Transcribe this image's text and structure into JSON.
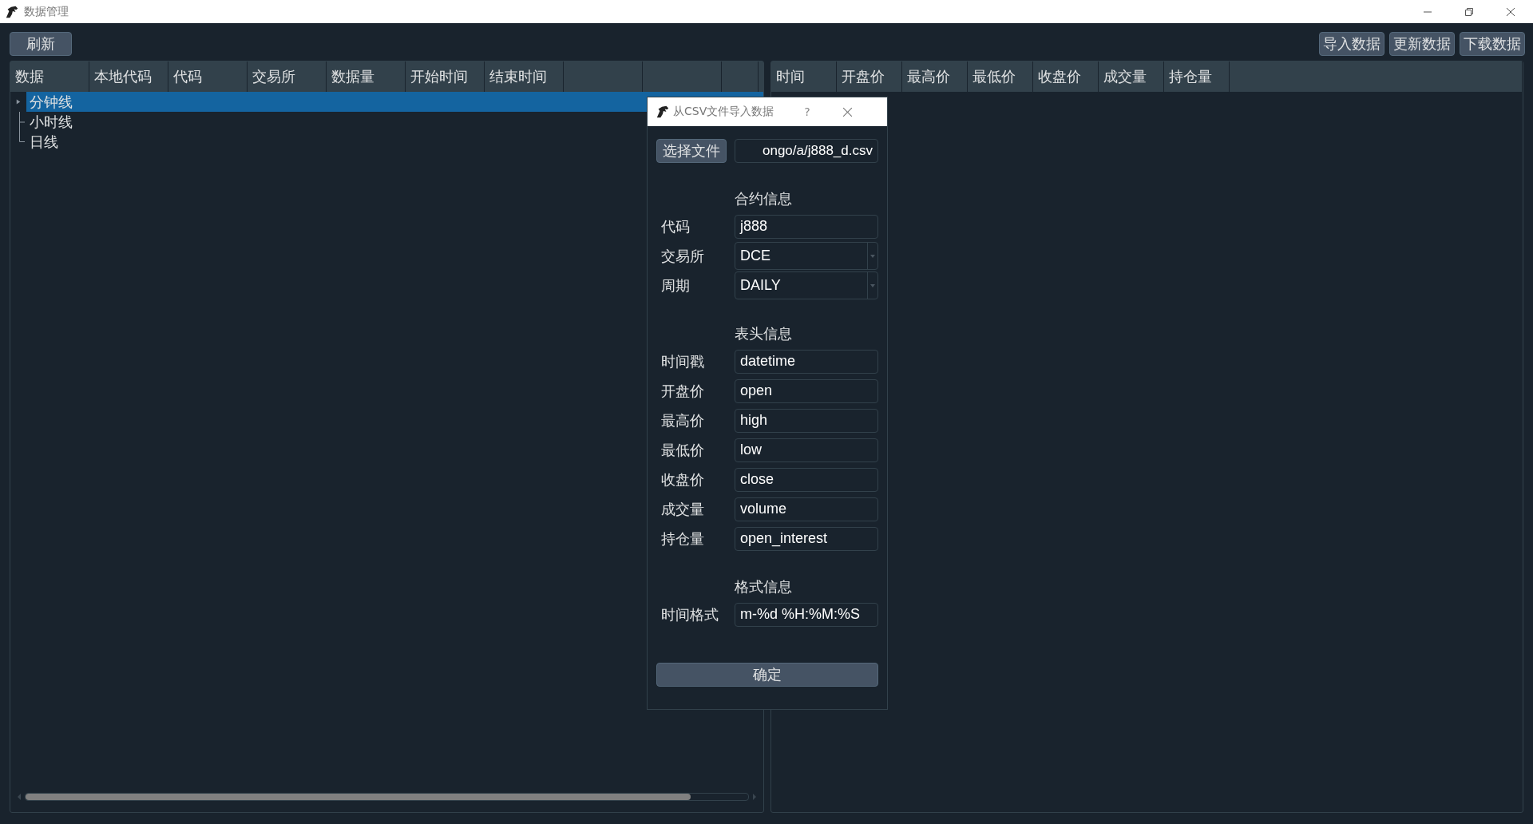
{
  "window": {
    "title": "数据管理"
  },
  "toolbar": {
    "left_buttons": [
      "刷新"
    ],
    "right_buttons": [
      "导入数据",
      "更新数据",
      "下载数据"
    ]
  },
  "data_tree": {
    "columns": [
      "数据",
      "本地代码",
      "代码",
      "交易所",
      "数据量",
      "开始时间",
      "结束时间"
    ],
    "items": [
      {
        "label": "分钟线",
        "selected": true,
        "expandable": true
      },
      {
        "label": "小时线",
        "selected": false,
        "expandable": false
      },
      {
        "label": "日线",
        "selected": false,
        "expandable": false
      }
    ]
  },
  "bar_table": {
    "columns": [
      "时间",
      "开盘价",
      "最高价",
      "最低价",
      "收盘价",
      "成交量",
      "持仓量"
    ]
  },
  "dialog": {
    "title": "从CSV文件导入数据",
    "help_label": "?",
    "file_button": "选择文件",
    "file_path": "ongo/a/j888_d.csv",
    "sections": [
      {
        "title": "合约信息",
        "fields": [
          {
            "label": "代码",
            "kind": "text",
            "value": "j888"
          },
          {
            "label": "交易所",
            "kind": "combo",
            "value": "DCE"
          },
          {
            "label": "周期",
            "kind": "combo",
            "value": "DAILY"
          }
        ]
      },
      {
        "title": "表头信息",
        "fields": [
          {
            "label": "时间戳",
            "kind": "text",
            "value": "datetime"
          },
          {
            "label": "开盘价",
            "kind": "text",
            "value": "open"
          },
          {
            "label": "最高价",
            "kind": "text",
            "value": "high"
          },
          {
            "label": "最低价",
            "kind": "text",
            "value": "low"
          },
          {
            "label": "收盘价",
            "kind": "text",
            "value": "close"
          },
          {
            "label": "成交量",
            "kind": "text",
            "value": "volume"
          },
          {
            "label": "持仓量",
            "kind": "text",
            "value": "open_interest"
          }
        ]
      },
      {
        "title": "格式信息",
        "fields": [
          {
            "label": "时间格式",
            "kind": "text",
            "value": "m-%d %H:%M:%S"
          }
        ]
      }
    ],
    "confirm_button": "确定"
  }
}
